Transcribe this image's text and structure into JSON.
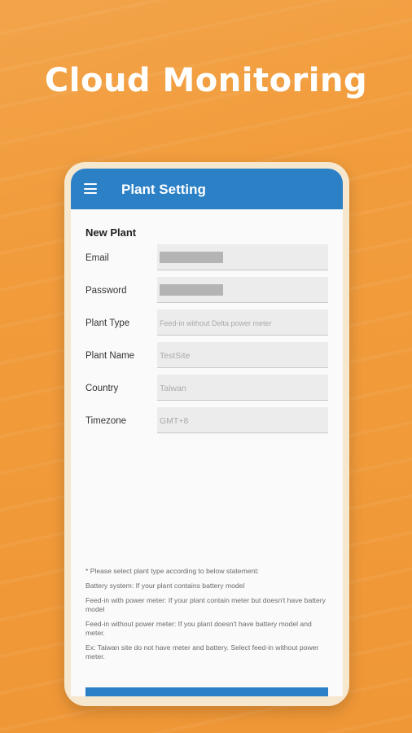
{
  "headline": "Cloud Monitoring",
  "app": {
    "title": "Plant Setting",
    "menu_icon": "hamburger-menu-icon",
    "accent_color": "#2b80c6",
    "background_color": "#f09a3a"
  },
  "form": {
    "section_title": "New Plant",
    "fields": [
      {
        "label": "Email",
        "value": "",
        "masked": true
      },
      {
        "label": "Password",
        "value": "",
        "masked": true
      },
      {
        "label": "Plant Type",
        "value": "Feed-in without Delta power meter"
      },
      {
        "label": "Plant Name",
        "value": "TestSite"
      },
      {
        "label": "Country",
        "value": "Taiwan"
      },
      {
        "label": "Timezone",
        "value": "GMT+8"
      }
    ]
  },
  "notes": [
    "* Please select plant type according to below statement:",
    "Battery system: If your plant contains battery model",
    "Feed-in with power meter: If your plant contain meter but doesn't have battery model",
    "Feed-in without power meter: If you plant doesn't have battery model and meter.",
    "Ex: Taiwan site do not have meter and battery. Select feed-in without power meter."
  ]
}
